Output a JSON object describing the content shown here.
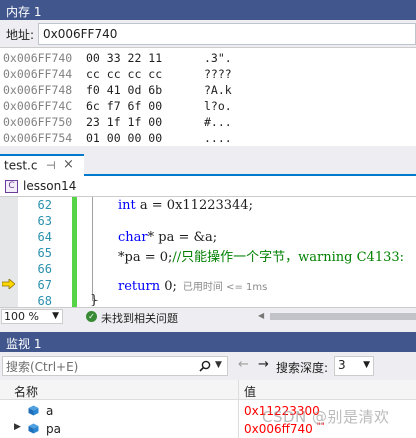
{
  "memory": {
    "title": "内存 1",
    "address_label": "地址:",
    "address_value": "0x006FF740",
    "rows": [
      {
        "addr": "0x006FF740",
        "bytes": "00 33 22 11",
        "chars": ".3\"."
      },
      {
        "addr": "0x006FF744",
        "bytes": "cc cc cc cc",
        "chars": "????"
      },
      {
        "addr": "0x006FF748",
        "bytes": "f0 41 0d 6b",
        "chars": "?A.k"
      },
      {
        "addr": "0x006FF74C",
        "bytes": "6c f7 6f 00",
        "chars": "l?o."
      },
      {
        "addr": "0x006FF750",
        "bytes": "23 1f 1f 00",
        "chars": "#..."
      },
      {
        "addr": "0x006FF754",
        "bytes": "01 00 00 00",
        "chars": "...."
      }
    ]
  },
  "editor": {
    "tab_label": "test.c",
    "tab_pin_icon": "pin-icon",
    "tab_close": "×",
    "project_icon": "project-icon",
    "project_name": "lesson14",
    "lines": [
      {
        "num": "62",
        "kw": "int",
        "text": " a = 0x11223344;",
        "comment": "",
        "hint": ""
      },
      {
        "num": "63",
        "kw": "",
        "text": "",
        "comment": "",
        "hint": ""
      },
      {
        "num": "64",
        "kw": "char",
        "text": "* pa = &a;",
        "comment": "",
        "hint": ""
      },
      {
        "num": "65",
        "kw": "",
        "text": "*pa = 0;",
        "comment": "//只能操作一个字节，warning C4133:",
        "hint": ""
      },
      {
        "num": "66",
        "kw": "",
        "text": "",
        "comment": "",
        "hint": ""
      },
      {
        "num": "67",
        "kw": "return",
        "text": " 0;",
        "comment": "",
        "hint": "已用时间 <= 1ms"
      },
      {
        "num": "68",
        "kw": "",
        "text": "}",
        "comment": "",
        "hint": ""
      }
    ],
    "current_line_icon": "instruction-pointer-arrow-icon",
    "zoom": "100 %",
    "issues_icon": "check-circle-icon",
    "issues_text": "未找到相关问题"
  },
  "watch": {
    "title": "监视 1",
    "search_placeholder": "搜索(Ctrl+E)",
    "search_icon": "search-icon",
    "nav_back": "←",
    "nav_forward": "→",
    "depth_label": "搜索深度:",
    "depth_value": "3",
    "col_name": "名称",
    "col_value": "值",
    "items": [
      {
        "name": "a",
        "value": "0x11223300",
        "expandable": false,
        "icon": "variable-cube-icon"
      },
      {
        "name": "pa",
        "value": "0x006ff740",
        "suffix": "\"\"",
        "expandable": true,
        "icon": "variable-cube-icon"
      }
    ]
  },
  "watermark": "CSDN @别是清欢",
  "colors": {
    "panel_title_bg": "#40568d",
    "accent": "#007acc",
    "changed_value": "#ff0000",
    "line_number": "#2b91af",
    "keyword": "#0000ff",
    "comment": "#008000",
    "change_bar": "#57d347"
  }
}
